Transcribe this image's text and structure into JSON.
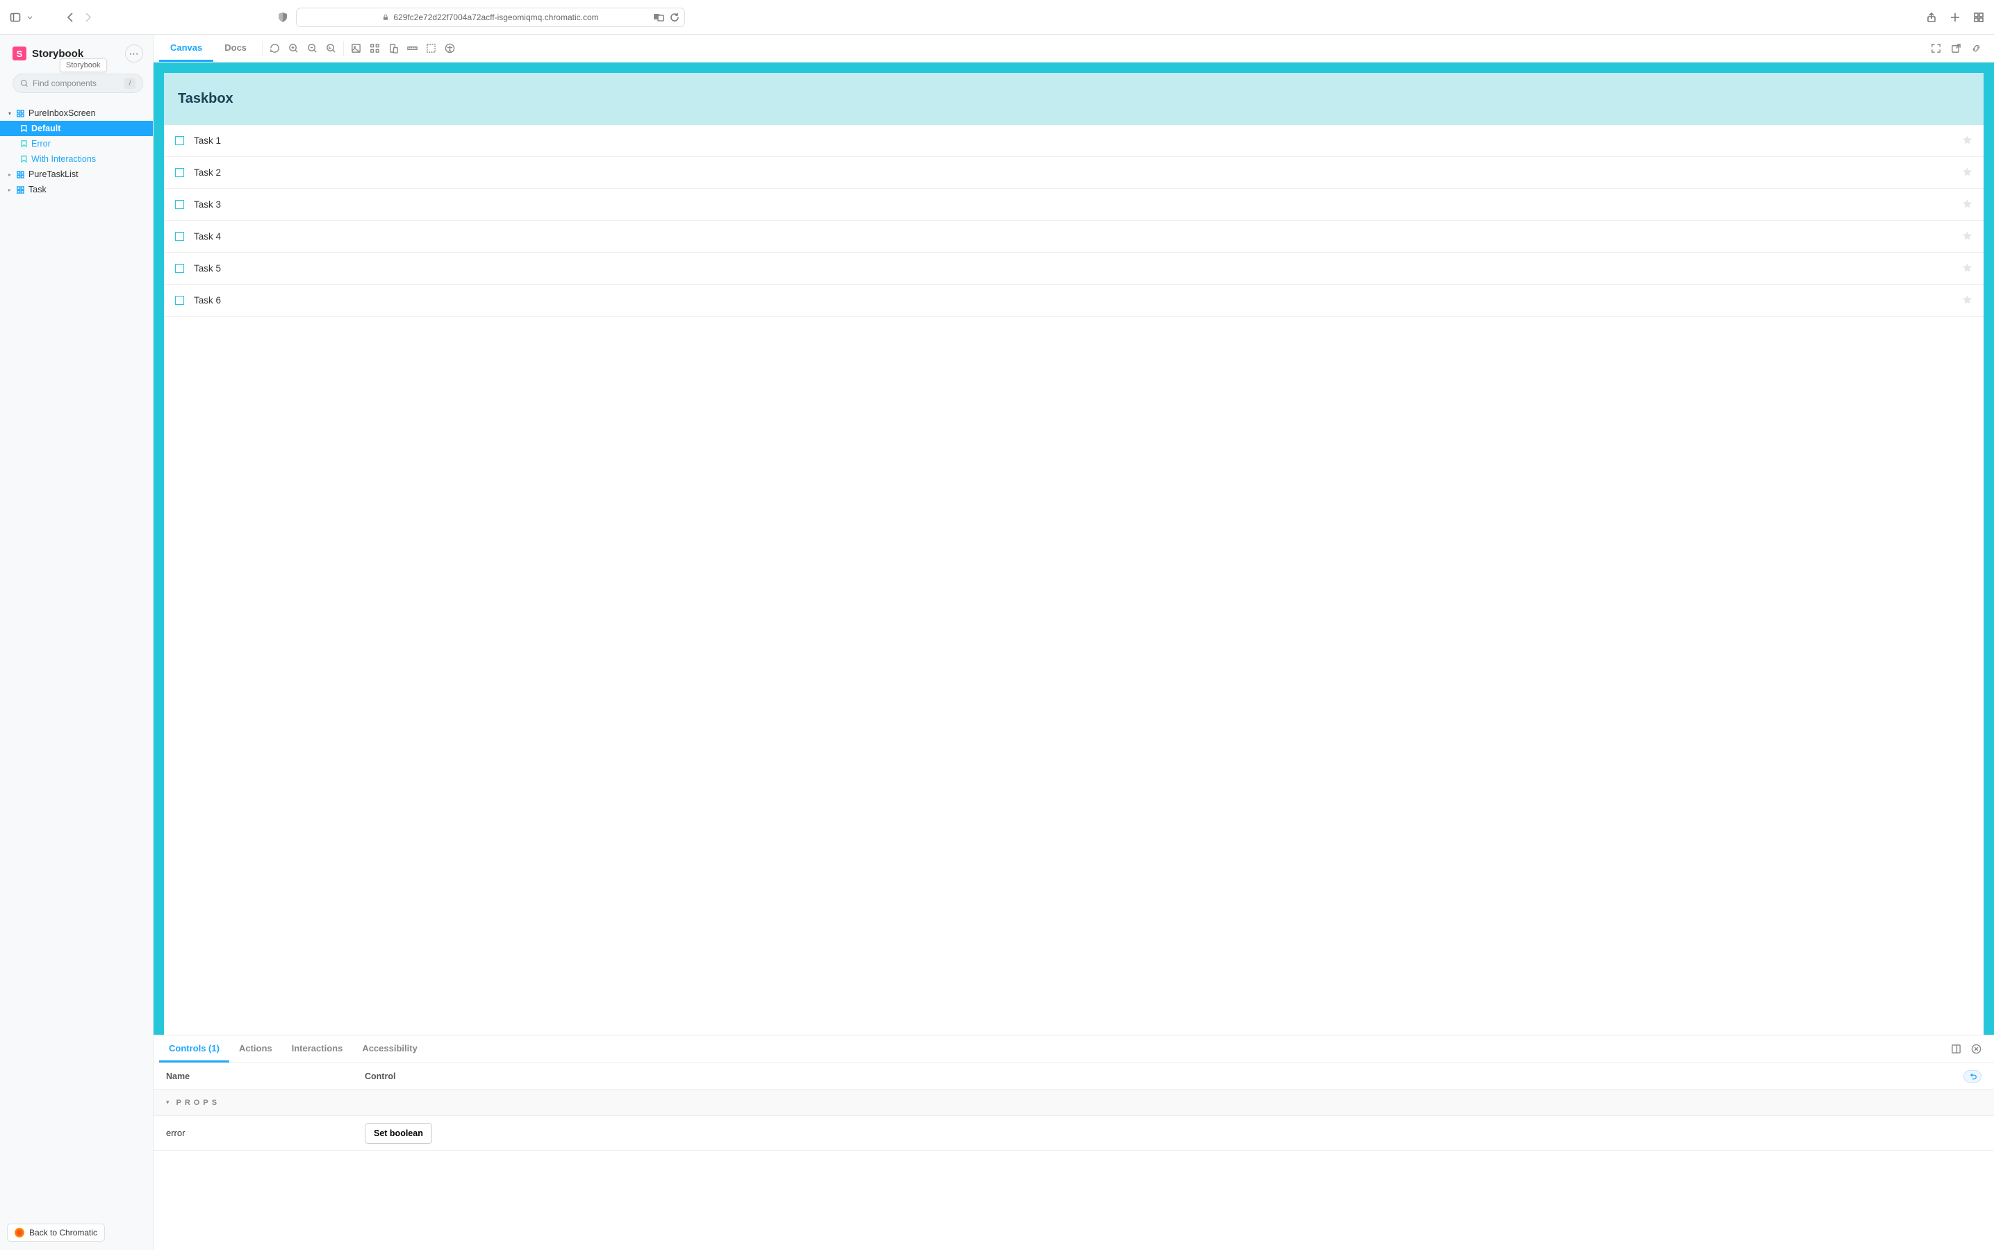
{
  "browser": {
    "url": "629fc2e72d22f7004a72acff-isgeomiqmq.chromatic.com"
  },
  "sidebar": {
    "brand": "Storybook",
    "logo_letter": "S",
    "tooltip": "Storybook",
    "search_placeholder": "Find components",
    "search_key": "/",
    "nav": [
      {
        "type": "component",
        "label": "PureInboxScreen",
        "expanded": true,
        "children": [
          {
            "type": "story",
            "label": "Default",
            "active": true
          },
          {
            "type": "story",
            "label": "Error",
            "active": false
          },
          {
            "type": "story",
            "label": "With Interactions",
            "active": false
          }
        ]
      },
      {
        "type": "component",
        "label": "PureTaskList",
        "expanded": false
      },
      {
        "type": "component",
        "label": "Task",
        "expanded": false
      }
    ],
    "chromatic_link": "Back to Chromatic"
  },
  "toolbar": {
    "tabs": [
      {
        "label": "Canvas",
        "active": true
      },
      {
        "label": "Docs",
        "active": false
      }
    ]
  },
  "canvas": {
    "header": "Taskbox",
    "tasks": [
      {
        "title": "Task 1"
      },
      {
        "title": "Task 2"
      },
      {
        "title": "Task 3"
      },
      {
        "title": "Task 4"
      },
      {
        "title": "Task 5"
      },
      {
        "title": "Task 6"
      }
    ]
  },
  "addons": {
    "tabs": [
      {
        "label": "Controls (1)",
        "active": true
      },
      {
        "label": "Actions",
        "active": false
      },
      {
        "label": "Interactions",
        "active": false
      },
      {
        "label": "Accessibility",
        "active": false
      }
    ],
    "cols": {
      "name": "Name",
      "control": "Control"
    },
    "section": "PROPS",
    "rows": [
      {
        "name": "error",
        "control_label": "Set boolean"
      }
    ]
  }
}
